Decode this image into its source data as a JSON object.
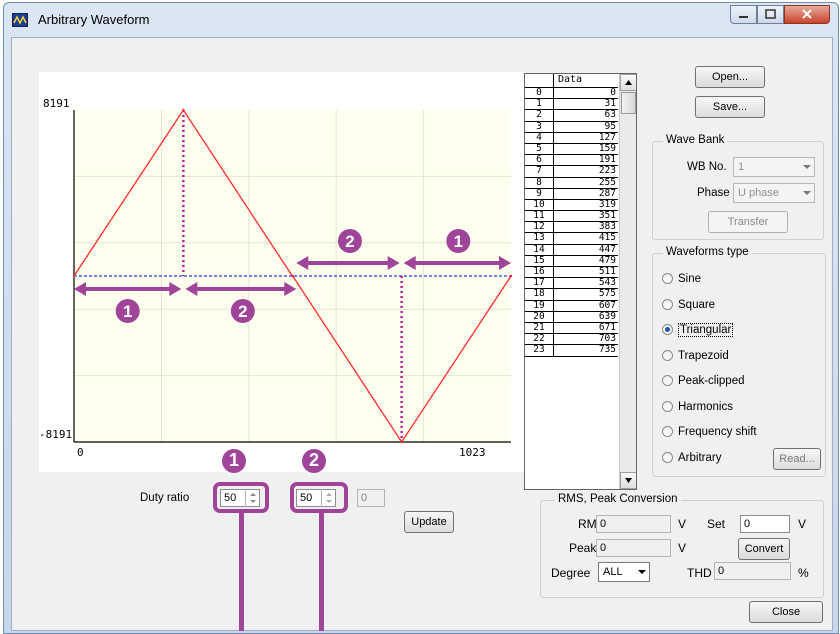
{
  "window": {
    "title": "Arbitrary Waveform"
  },
  "plot": {
    "y_max_label": "8191",
    "y_min_label": "-8191",
    "x_min_label": "0",
    "x_max_label": "1023",
    "annotations": [
      "1",
      "2",
      "2",
      "1"
    ],
    "colors": {
      "background": "#fffff0",
      "waveform": "#ff2a2a",
      "baseline": "#1f3fe0",
      "annotation": "#a0449a"
    }
  },
  "chart_data": {
    "type": "line",
    "x": [
      0,
      256,
      511,
      512,
      767,
      1023
    ],
    "y": [
      0,
      8191,
      0,
      0,
      -8191,
      0
    ],
    "xlim": [
      0,
      1023
    ],
    "ylim": [
      -8191,
      8191
    ],
    "tick_labels": {
      "x": [
        "0",
        "1023"
      ],
      "y": [
        "8191",
        "-8191"
      ]
    },
    "grid": true
  },
  "duty": {
    "label": "Duty ratio",
    "value1": "50",
    "separator": ":",
    "value2": "50",
    "value3": "0",
    "badge1": "1",
    "badge2": "2",
    "update_label": "Update"
  },
  "table": {
    "header": "Data",
    "rows": [
      [
        "0",
        "0"
      ],
      [
        "1",
        "31"
      ],
      [
        "2",
        "63"
      ],
      [
        "3",
        "95"
      ],
      [
        "4",
        "127"
      ],
      [
        "5",
        "159"
      ],
      [
        "6",
        "191"
      ],
      [
        "7",
        "223"
      ],
      [
        "8",
        "255"
      ],
      [
        "9",
        "287"
      ],
      [
        "10",
        "319"
      ],
      [
        "11",
        "351"
      ],
      [
        "12",
        "383"
      ],
      [
        "13",
        "415"
      ],
      [
        "14",
        "447"
      ],
      [
        "15",
        "479"
      ],
      [
        "16",
        "511"
      ],
      [
        "17",
        "543"
      ],
      [
        "18",
        "575"
      ],
      [
        "19",
        "607"
      ],
      [
        "20",
        "639"
      ],
      [
        "21",
        "671"
      ],
      [
        "22",
        "703"
      ],
      [
        "23",
        "735"
      ]
    ]
  },
  "buttons": {
    "open": "Open...",
    "save": "Save...",
    "transfer": "Transfer",
    "read": "Read...",
    "convert": "Convert",
    "close": "Close"
  },
  "wave_bank": {
    "title": "Wave Bank",
    "wb_no_label": "WB No.",
    "wb_no_value": "1",
    "phase_label": "Phase",
    "phase_value": "U phase"
  },
  "waveforms": {
    "title": "Waveforms type",
    "selected": "Triangular",
    "options": [
      "Sine",
      "Square",
      "Triangular",
      "Trapezoid",
      "Peak-clipped",
      "Harmonics",
      "Frequency shift",
      "Arbitrary"
    ]
  },
  "rms": {
    "title": "RMS, Peak Conversion",
    "rms_label": "RMS",
    "rms_value": "0",
    "rms_unit": "V",
    "set_label": "Set",
    "set_value": "0",
    "set_unit": "V",
    "peak_label": "Peak",
    "peak_value": "0",
    "peak_unit": "V",
    "degree_label": "Degree",
    "degree_value": "ALL",
    "thd_label": "THD",
    "thd_value": "0",
    "thd_unit": "%"
  }
}
